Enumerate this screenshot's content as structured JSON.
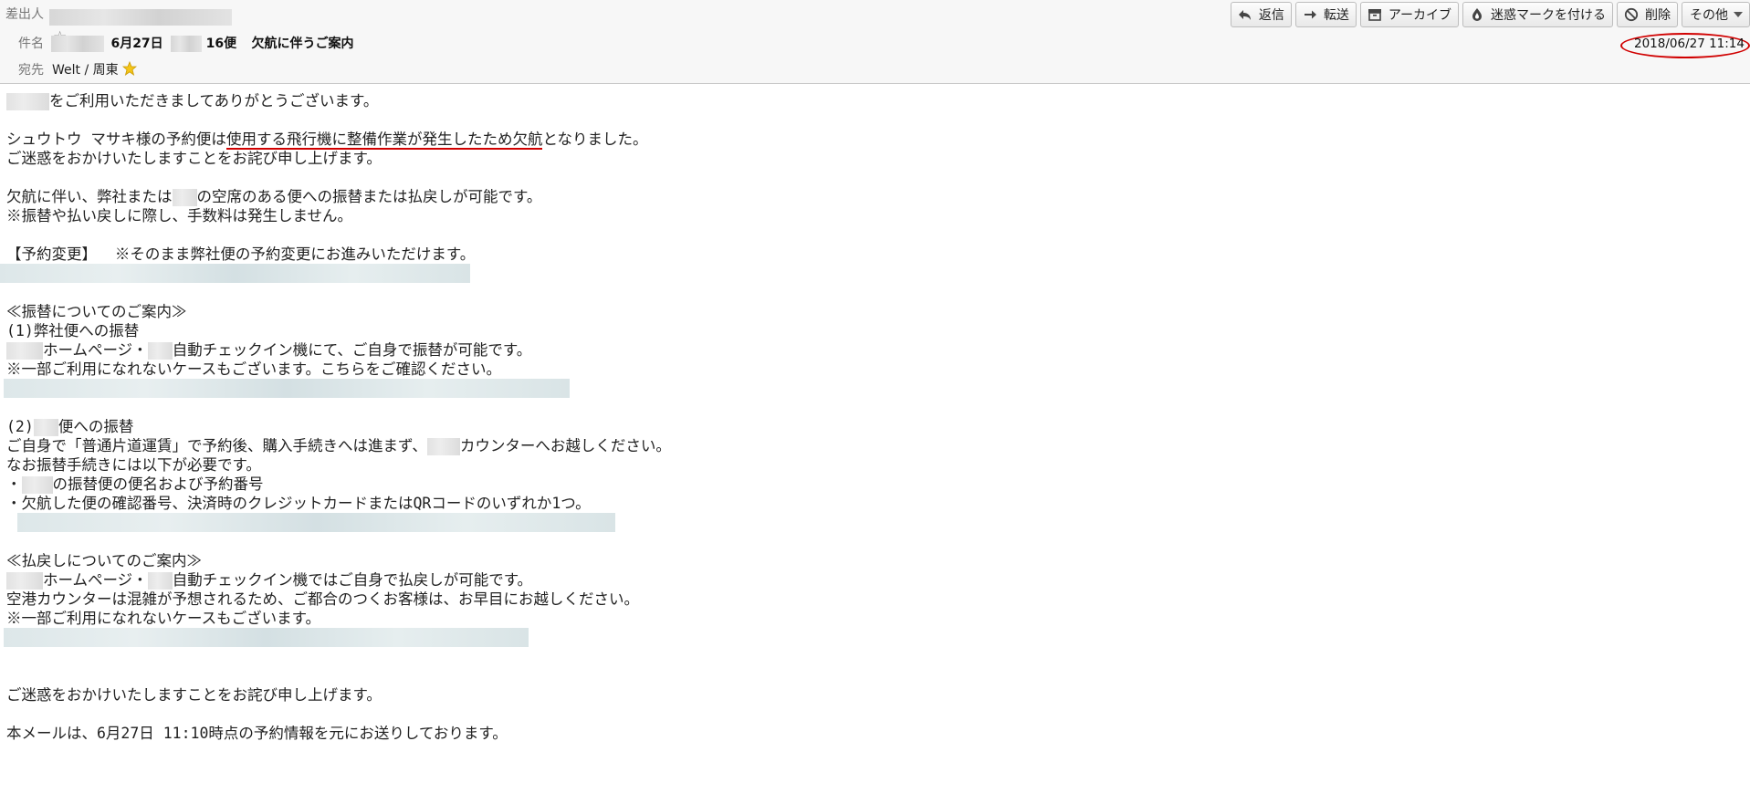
{
  "header": {
    "from_label": "差出人",
    "subject_label": "件名",
    "subject_date": "6月27日",
    "subject_flight": "16便",
    "subject_text": "欠航に伴うご案内",
    "to_label": "宛先",
    "to_value": "Welt / 周東",
    "date": "2018/06/27 11:14"
  },
  "toolbar": {
    "reply": "返信",
    "forward": "転送",
    "archive": "アーカイブ",
    "junk": "迷惑マークを付ける",
    "delete": "削除",
    "other": "その他"
  },
  "body": {
    "l1": "をご利用いただきましてありがとうございます。",
    "l2a": "シュウトウ マサキ様の予約便は",
    "l2b": "使用する飛行機に整備作業が発生したため欠航",
    "l2c": "となりました。",
    "l3": "ご迷惑をおかけいたしますことをお詫び申し上げます。",
    "l4a": "欠航に伴い、弊社または",
    "l4b": "の空席のある便への振替または払戻しが可能です。",
    "l5": "※振替や払い戻しに際し、手数料は発生しません。",
    "l6": "【予約変更】  ※そのまま弊社便の予約変更にお進みいただけます。",
    "l7": "≪振替についてのご案内≫",
    "l8": "(1)弊社便への振替",
    "l9a": "ホームページ・",
    "l9b": "自動チェックイン機にて、ご自身で振替が可能です。",
    "l10": "※一部ご利用になれないケースもございます。こちらをご確認ください。",
    "l11a": "(2)",
    "l11b": "便への振替",
    "l12a": "ご自身で「普通片道運賃」で予約後、購入手続きへは進まず、",
    "l12b": "カウンターへお越しください。",
    "l13": "なお振替手続きには以下が必要です。",
    "l14a": "・",
    "l14b": "の振替便の便名および予約番号",
    "l15": "・欠航した便の確認番号、決済時のクレジットカードまたはQRコードのいずれか1つ。",
    "l16": "≪払戻しについてのご案内≫",
    "l17a": "ホームページ・",
    "l17b": "自動チェックイン機ではご自身で払戻しが可能です。",
    "l18": "空港カウンターは混雑が予想されるため、ご都合のつくお客様は、お早目にお越しください。",
    "l19": "※一部ご利用になれないケースもございます。",
    "l20": "ご迷惑をおかけいたしますことをお詫び申し上げます。",
    "l21": "本メールは、6月27日 11:10時点の予約情報を元にお送りしております。"
  },
  "colors": {
    "annotation_red": "#d00000",
    "header_bg": "#f7f7f7"
  },
  "icons": [
    "star-icon",
    "reply-icon",
    "forward-icon",
    "archive-icon",
    "junk-icon",
    "delete-icon",
    "dropdown-icon",
    "star-emoji-icon"
  ]
}
